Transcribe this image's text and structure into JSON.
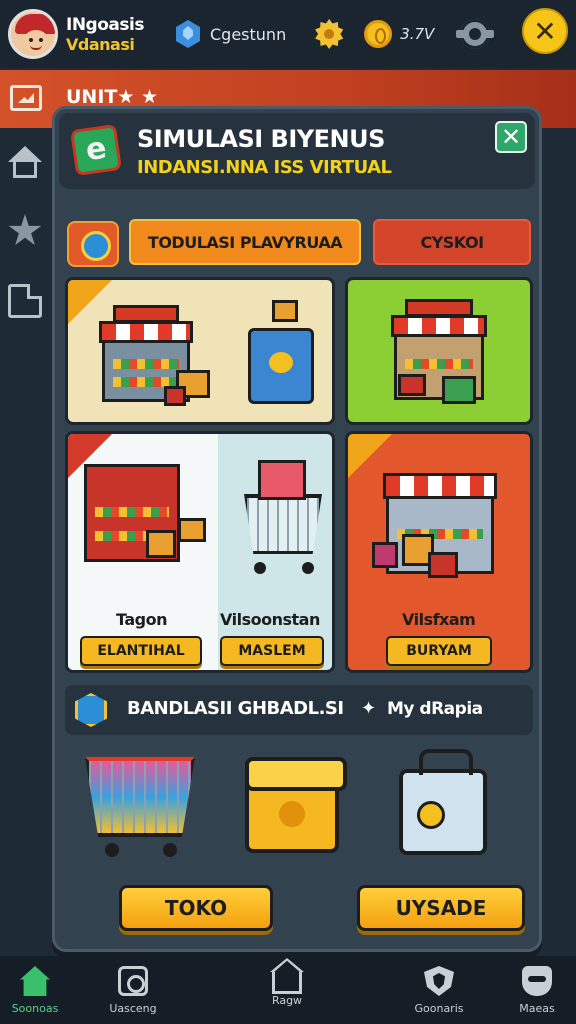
{
  "player": {
    "name": "INgoasis",
    "subtitle": "Vdanasi"
  },
  "stats": {
    "gem_text": "Cgestunn",
    "coin_text": "3.7V"
  },
  "stripe": {
    "label": "UNIT★ ★"
  },
  "panel": {
    "title": "SIMULASI BIYENUS",
    "subtitle": "INDANSI.NNA ISS VIRTUAL"
  },
  "tabs": [
    {
      "label": "TODULASI PLAVYRUAA"
    },
    {
      "label": "CYSKOI"
    }
  ],
  "cards": {
    "warung": {
      "label": "Tagon",
      "button": "ELANTIHAL"
    },
    "minimarket": {
      "label": "Vilsoonstan",
      "button": "MASLEM"
    },
    "toko": {
      "label": "Vilsfxam",
      "button": "BURYAM"
    }
  },
  "section": {
    "title": "BANDLASII GHBADL.SI",
    "separator": "✦",
    "extra": "My dRapia"
  },
  "actions": {
    "toko": "TOKO",
    "upgrade": "UYSADE"
  },
  "nav": [
    {
      "label": "Soonoas",
      "icon": "home-icon"
    },
    {
      "label": "Uasceng",
      "icon": "target-icon"
    },
    {
      "label": "Ragw",
      "icon": "house-icon"
    },
    {
      "label": "Goonaris",
      "icon": "shield-icon"
    },
    {
      "label": "Maeas",
      "icon": "mask-icon"
    }
  ],
  "colors": {
    "accent_yellow": "#f5b820",
    "accent_orange": "#e25a28",
    "panel_bg": "#33424f",
    "active_green": "#3abf6a"
  }
}
